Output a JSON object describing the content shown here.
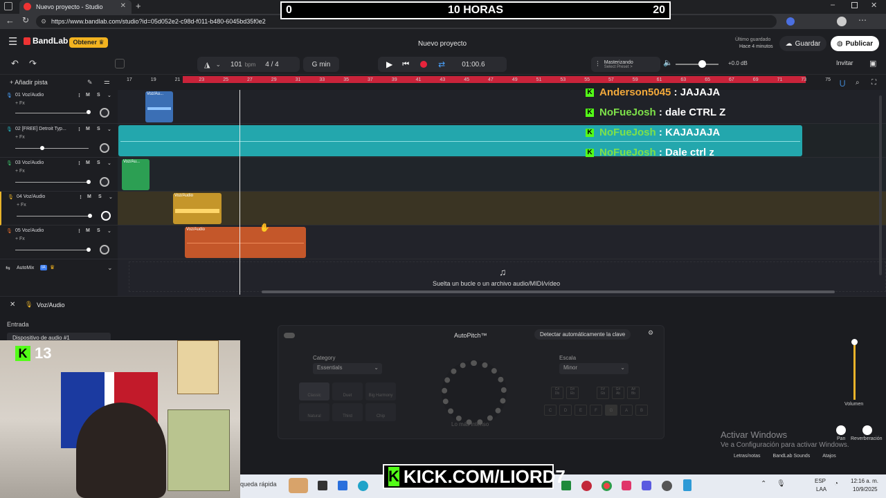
{
  "browser": {
    "tab_title": "Nuevo proyecto - Studio",
    "url": "https://www.bandlab.com/studio?id=05d052e2-c98d-f011-b480-6045bd35f0e2"
  },
  "timer": {
    "left": "0",
    "center": "10 HORAS",
    "right": "20"
  },
  "app": {
    "brand": "BandLab",
    "get_button": "Obtener",
    "project_title": "Nuevo proyecto",
    "saved_line1": "Último guardado",
    "saved_line2": "Hace 4 minutos",
    "save_button": "Guardar",
    "publish_button": "Publicar",
    "invite_button": "Invitar"
  },
  "transport": {
    "bpm_value": "101",
    "bpm_unit": "bpm",
    "time_signature": "4 / 4",
    "key": "G min",
    "time": "01:00.6",
    "mastering_title": "Masterizando",
    "mastering_sub": "Select Preset >",
    "master_volume": "+0.0 dB"
  },
  "track_panel": {
    "add_track": "Añadir pista",
    "tracks": [
      {
        "name": "01 Voz/Audio",
        "fx": "+ Fx",
        "m": "M",
        "s": "S"
      },
      {
        "name": "02 [FREE] Detroit Typ...",
        "fx": "+ Fx",
        "m": "M",
        "s": "S"
      },
      {
        "name": "03 Voz/Audio",
        "fx": "+ Fx",
        "m": "M",
        "s": "S"
      },
      {
        "name": "04 Voz/Audio",
        "fx": "+ Fx",
        "m": "M",
        "s": "S"
      },
      {
        "name": "05 Voz/Audio",
        "fx": "+ Fx",
        "m": "M",
        "s": "S"
      }
    ],
    "automix_label": "AutoMix",
    "automix_badge": "IA"
  },
  "ruler_ticks": [
    "17",
    "19",
    "21",
    "23",
    "25",
    "27",
    "29",
    "31",
    "33",
    "35",
    "37",
    "39",
    "41",
    "43",
    "45",
    "47",
    "49",
    "51",
    "53",
    "55",
    "57",
    "59",
    "61",
    "63",
    "65",
    "67",
    "69",
    "71",
    "73",
    "75"
  ],
  "clips": [
    {
      "label": "Voz/Au..."
    },
    {
      "label": "Voz/Au..."
    },
    {
      "label": "Voz/Audio"
    },
    {
      "label": "Voz/Audio"
    }
  ],
  "chat": [
    {
      "user": "Anderson5045",
      "sep": " : ",
      "msg": "JAJAJA",
      "color": "#f2a93b"
    },
    {
      "user": "NoFueJosh",
      "sep": " : ",
      "msg": "dale CTRL Z",
      "color": "#7ee14a"
    },
    {
      "user": "NoFueJosh",
      "sep": " : ",
      "msg": "KAJAJAJA",
      "color": "#7ee14a"
    },
    {
      "user": "NoFueJosh",
      "sep": " : ",
      "msg": "Dale ctrl z",
      "color": "#7ee14a"
    }
  ],
  "drop_zone_text": "Suelta un bucle o un archivo audio/MIDI/vídeo",
  "editor": {
    "track_label": "Voz/Audio",
    "input_label": "Entrada",
    "input_device": "Dispositivo de audio #1",
    "plugin_title": "AutoPitch™",
    "detect_key_button": "Detectar automáticamente la clave",
    "category_label": "Category",
    "category_value": "Essentials",
    "presets": [
      "Classic",
      "Duet",
      "Big Harmony",
      "Natural",
      "Third",
      "Chip"
    ],
    "knob_label": "Lo más intenso",
    "scale_label": "Escala",
    "scale_value": "Minor",
    "notes_top": [
      "C#\nDb",
      "D#\nEb",
      "F#\nGb",
      "G#\nAb",
      "A#\nBb"
    ],
    "notes_bottom": [
      "C",
      "D",
      "E",
      "F",
      "G",
      "A",
      "B"
    ],
    "volume_label": "Volumen",
    "pan_label": "Pan",
    "reverb_label": "Reverberación",
    "activate_title": "Activar Windows",
    "activate_sub": "Ve a Configuración para activar Windows.",
    "bottom_tabs": [
      "Letras/notas",
      "BandLab Sounds",
      "Atajos"
    ]
  },
  "overlay": {
    "kick_count": "13",
    "kick_banner": "KICK.COM/LIORD7"
  },
  "taskbar": {
    "search_text": "queda rápida",
    "lang_line1": "ESP",
    "lang_line2": "LAA",
    "time": "12:16 a. m.",
    "date": "10/9/2025"
  }
}
